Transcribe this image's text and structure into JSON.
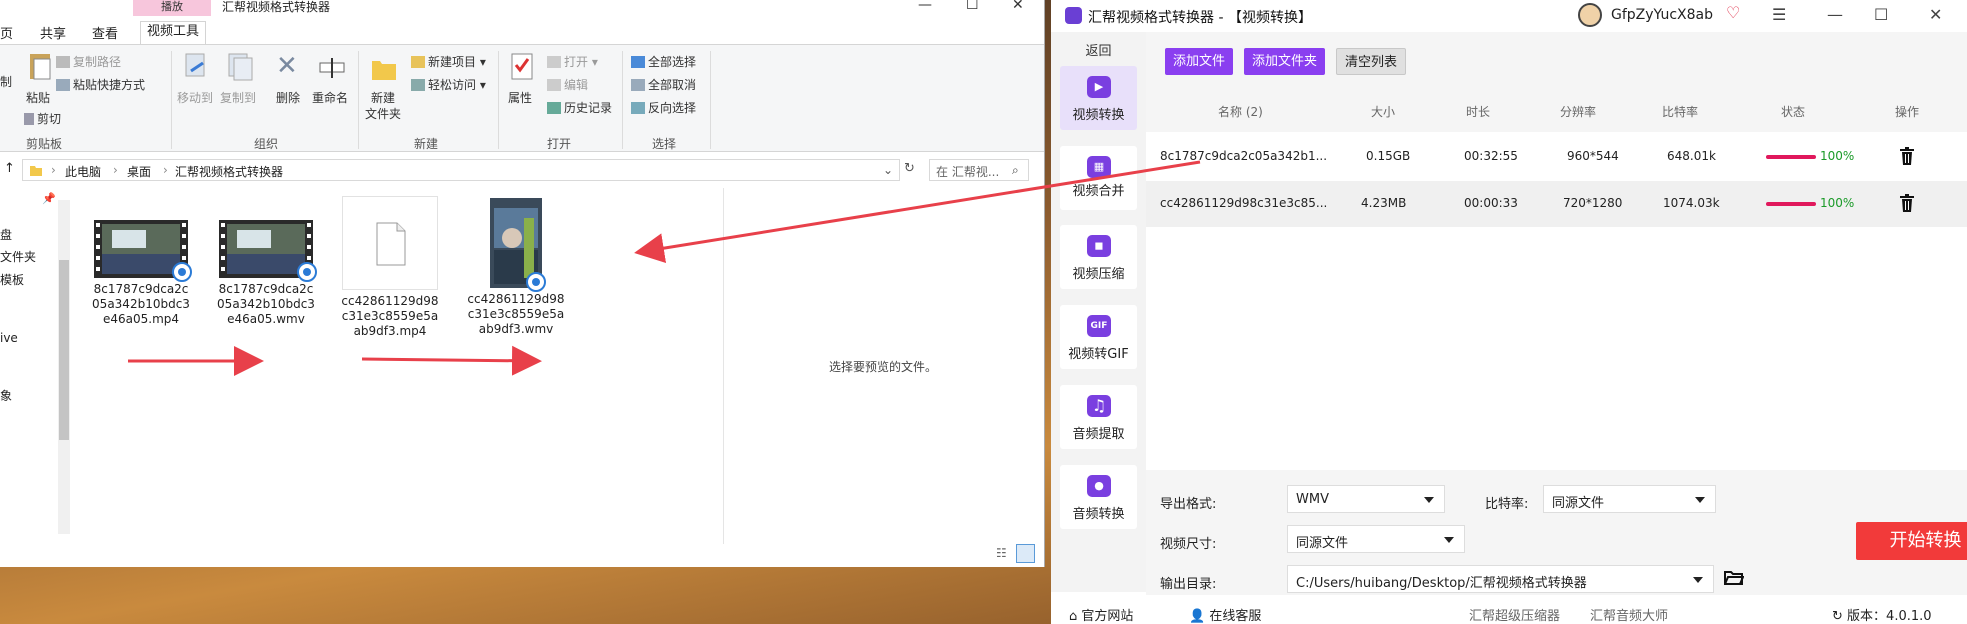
{
  "explorer": {
    "context_tab": "播放",
    "title": "汇帮视频格式转换器",
    "tabs": [
      "页",
      "共享",
      "查看",
      "视频工具"
    ],
    "ribbon": {
      "clipboard": {
        "copy_path": "复制路径",
        "paste_shortcut": "粘贴快捷方式",
        "paste": "粘贴",
        "cut": "剪切",
        "copy_stub": "制",
        "label": "剪贴板"
      },
      "organize": {
        "move_to": "移动到",
        "copy_to": "复制到",
        "delete": "删除",
        "rename": "重命名",
        "label": "组织"
      },
      "new": {
        "new_item": "新建项目",
        "easy_access": "轻松访问",
        "new_folder_l1": "新建",
        "new_folder_l2": "文件夹",
        "label": "新建"
      },
      "open": {
        "open": "打开",
        "edit": "编辑",
        "history": "历史记录",
        "properties": "属性",
        "label": "打开"
      },
      "select": {
        "select_all": "全部选择",
        "select_none": "全部取消",
        "invert": "反向选择",
        "label": "选择"
      }
    },
    "address": {
      "crumbs": [
        "此电脑",
        "桌面",
        "汇帮视频格式转换器"
      ],
      "search_placeholder": "在 汇帮视..."
    },
    "nav_items": [
      "盘",
      "文件夹",
      "模板",
      "ive",
      "象"
    ],
    "files": [
      {
        "name": "8c1787c9dca2c05a342b10bdc3e46a05.mp4",
        "type": "video"
      },
      {
        "name": "8c1787c9dca2c05a342b10bdc3e46a05.wmv",
        "type": "video"
      },
      {
        "name": "cc42861129d98c31e3c8559e5aab9df3.mp4",
        "type": "blank"
      },
      {
        "name": "cc42861129d98c31e3c8559e5aab9df3.wmv",
        "type": "portrait"
      }
    ],
    "preview_text": "选择要预览的文件。"
  },
  "app": {
    "title": "汇帮视频格式转换器 - 【视频转换】",
    "username": "GfpZyYucX8ab",
    "back": "返回",
    "sidebar": [
      {
        "label": "视频转换",
        "icon": "video-convert-icon",
        "glyph": "▶",
        "active": true
      },
      {
        "label": "视频合并",
        "icon": "video-merge-icon",
        "glyph": "▦",
        "active": false
      },
      {
        "label": "视频压缩",
        "icon": "video-compress-icon",
        "glyph": "◼",
        "active": false
      },
      {
        "label": "视频转GIF",
        "icon": "gif-icon",
        "glyph": "GIF",
        "active": false
      },
      {
        "label": "音频提取",
        "icon": "music-icon",
        "glyph": "♫",
        "active": false
      },
      {
        "label": "音频转换",
        "icon": "microphone-icon",
        "glyph": "●",
        "active": false
      }
    ],
    "toolbar": {
      "add_file": "添加文件",
      "add_folder": "添加文件夹",
      "clear_list": "清空列表"
    },
    "table": {
      "headers": [
        "名称 (2)",
        "大小",
        "时长",
        "分辨率",
        "比特率",
        "状态",
        "操作"
      ],
      "rows": [
        {
          "name": "8c1787c9dca2c05a342b1...",
          "size": "0.15GB",
          "duration": "00:32:55",
          "resolution": "960*544",
          "bitrate": "648.01k",
          "progress": 100,
          "pct": "100%"
        },
        {
          "name": "cc42861129d98c31e3c85...",
          "size": "4.23MB",
          "duration": "00:00:33",
          "resolution": "720*1280",
          "bitrate": "1074.03k",
          "progress": 100,
          "pct": "100%"
        }
      ]
    },
    "settings": {
      "format_label": "导出格式:",
      "format_value": "WMV",
      "bitrate_label": "比特率:",
      "bitrate_value": "同源文件",
      "size_label": "视频尺寸:",
      "size_value": "同源文件",
      "output_label": "输出目录:",
      "output_value": "C:/Users/huibang/Desktop/汇帮视频格式转换器",
      "start": "开始转换"
    },
    "footer": {
      "website": "官方网站",
      "service": "在线客服",
      "link1": "汇帮超级压缩器",
      "link2": "汇帮音频大师",
      "version": "版本：4.0.1.0"
    },
    "colors": {
      "accent": "#8a3ff0",
      "start": "#f23a3a",
      "progress": "#e0185c",
      "arrow": "#e8404a"
    }
  }
}
